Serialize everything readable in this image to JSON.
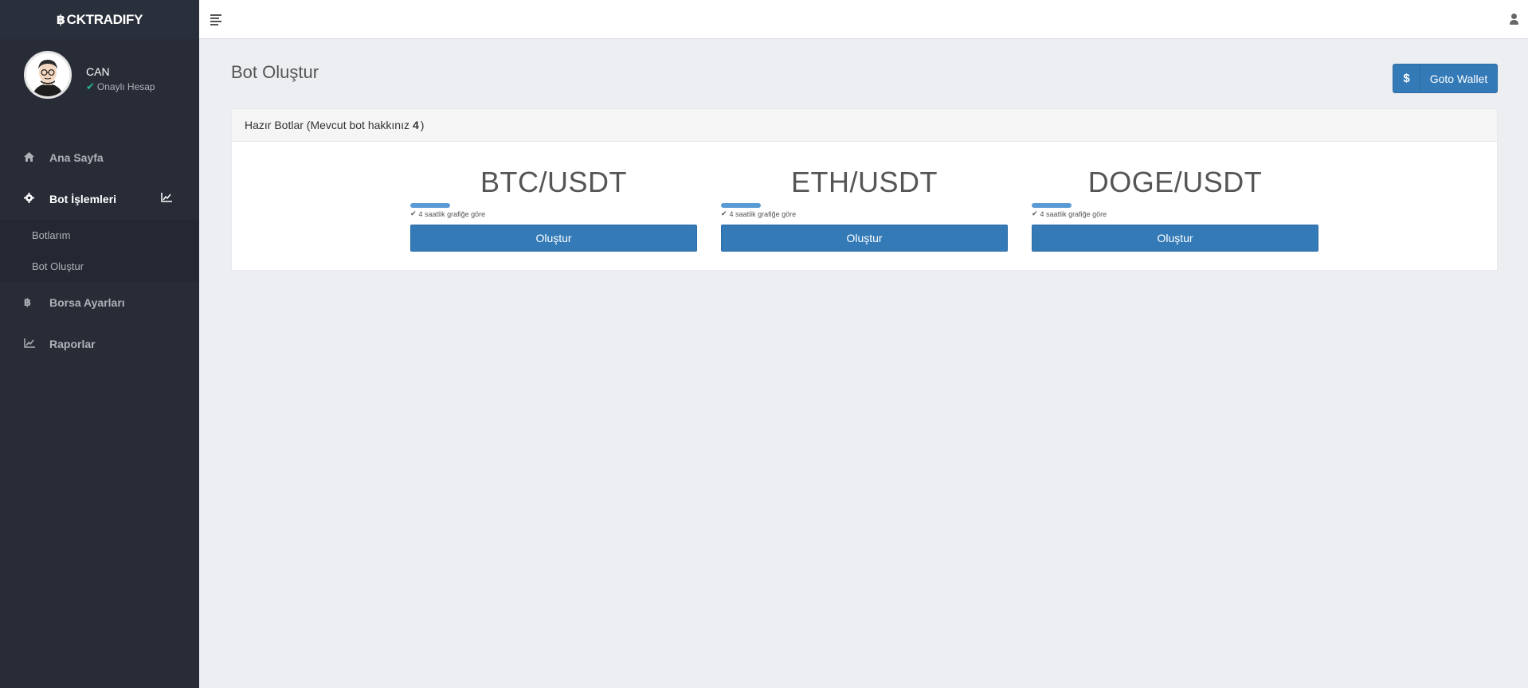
{
  "brand": {
    "icon": "bitcoin-icon",
    "name": "CKTRADIFY"
  },
  "profile": {
    "name": "CAN",
    "status": "Onaylı Hesap",
    "status_icon": "check-icon"
  },
  "sidebar": {
    "items": [
      {
        "label": "Ana Sayfa",
        "icon": "home-icon"
      },
      {
        "label": "Bot İşlemleri",
        "icon": "gear-icon",
        "right_icon": "line-chart-icon"
      },
      {
        "label": "Borsa Ayarları",
        "icon": "bitcoin-icon"
      },
      {
        "label": "Raporlar",
        "icon": "line-chart-icon"
      }
    ],
    "submenu": [
      {
        "label": "Botlarım"
      },
      {
        "label": "Bot Oluştur"
      }
    ]
  },
  "page": {
    "title": "Bot Oluştur"
  },
  "wallet": {
    "symbol": "$",
    "label": "Goto Wallet"
  },
  "panel": {
    "heading_prefix": "Hazır Botlar (Mevcut bot hakkınız",
    "heading_count": "4",
    "heading_suffix": ")"
  },
  "bots": [
    {
      "name": "BTC/USDT",
      "feature": "4 saatlik grafiğe göre",
      "button": "Oluştur"
    },
    {
      "name": "ETH/USDT",
      "feature": "4 saatlik grafiğe göre",
      "button": "Oluştur"
    },
    {
      "name": "DOGE/USDT",
      "feature": "4 saatlik grafiğe göre",
      "button": "Oluştur"
    }
  ],
  "colors": {
    "sidebar": "#272c37",
    "primary": "#337ab7",
    "accent_check": "#26b99a"
  }
}
